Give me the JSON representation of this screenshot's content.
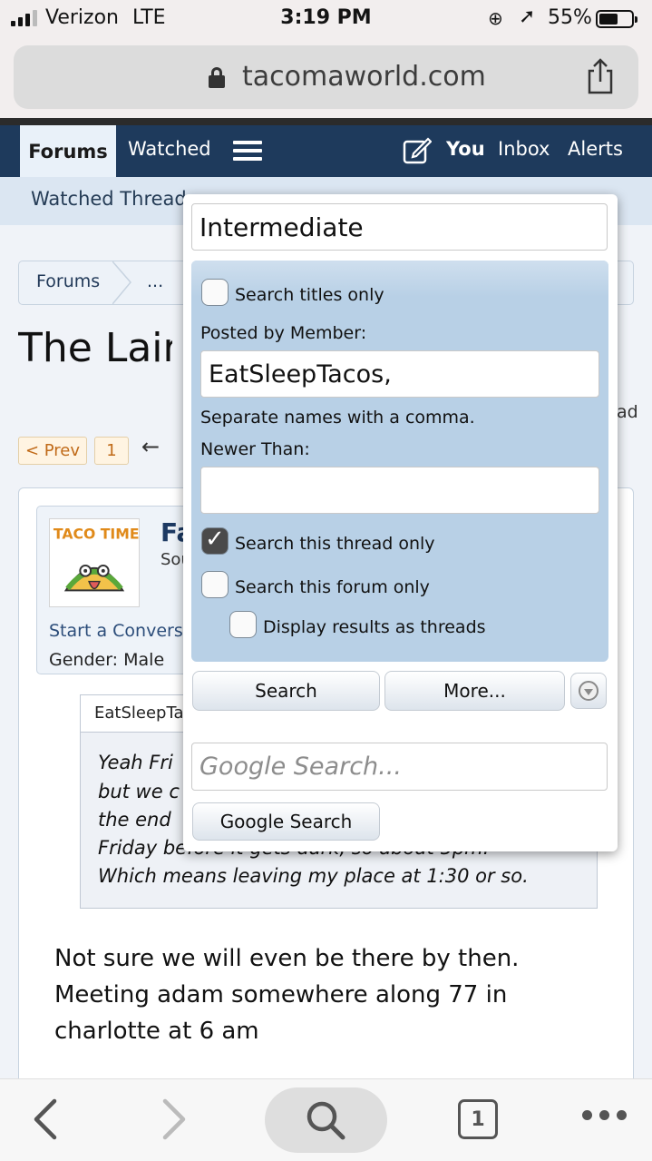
{
  "status_bar": {
    "carrier": "Verizon",
    "network": "LTE",
    "time": "3:19 PM",
    "battery_percent": "55%",
    "battery_level": 0.55
  },
  "browser": {
    "url": "tacomaworld.com",
    "open_tabs": "1"
  },
  "nav": {
    "tabs": [
      "Forums",
      "Watched"
    ],
    "user_links": [
      "You",
      "Inbox",
      "Alerts"
    ],
    "subnav_item": "Watched Threads"
  },
  "page": {
    "breadcrumbs": [
      "Forums",
      "..."
    ],
    "title": "The Lair",
    "right_fragment": "ad",
    "pagination": {
      "prev": "< Prev",
      "page1": "1",
      "arrow": "←"
    }
  },
  "post": {
    "username_fragment": "Fa",
    "user_title_fragment": "Sou",
    "start_conversation": "Start a Conversation",
    "gender_label": "Gender:",
    "gender_value": "Male",
    "quote_author": "EatSleepTacos",
    "quote_lines": [
      "Yeah Fri",
      "but we c",
      "the end",
      "Friday before it gets dark, so about 5pm.",
      "Which means leaving my place at 1:30 or so."
    ],
    "body_lines": [
      "Not sure we will even be there by then.",
      "Meeting adam somewhere along 77 in",
      "charlotte at 6 am"
    ]
  },
  "search_popup": {
    "keywords_value": "Intermediate",
    "search_titles_only": {
      "label": "Search titles only",
      "checked": false
    },
    "posted_by_label": "Posted by Member:",
    "posted_by_value": "EatSleepTacos,",
    "separate_hint": "Separate names with a comma.",
    "newer_than_label": "Newer Than:",
    "newer_than_value": "",
    "search_thread_only": {
      "label": "Search this thread only",
      "checked": true
    },
    "search_forum_only": {
      "label": "Search this forum only",
      "checked": false
    },
    "display_as_threads": {
      "label": "Display results as threads",
      "checked": false
    },
    "search_button": "Search",
    "more_button": "More...",
    "google_placeholder": "Google Search...",
    "google_button": "Google Search"
  }
}
